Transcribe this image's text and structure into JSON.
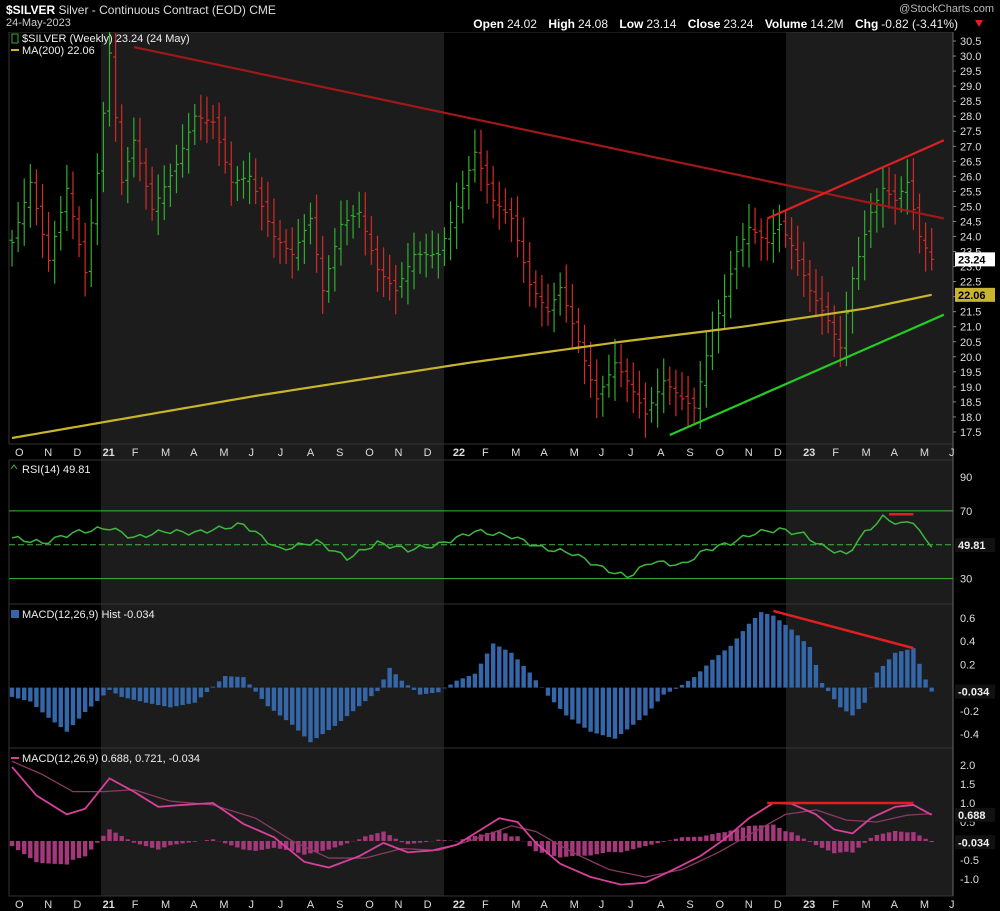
{
  "header": {
    "symbol": "$SILVER",
    "name": "Silver - Continuous Contract (EOD)",
    "exchange": "CME",
    "date": "24-May-2023",
    "watermark": "@StockCharts.com",
    "open_label": "Open",
    "open": "24.02",
    "high_label": "High",
    "high": "24.08",
    "low_label": "Low",
    "low": "23.14",
    "close_label": "Close",
    "close": "23.24",
    "volume_label": "Volume",
    "volume": "14.2M",
    "chg_label": "Chg",
    "chg": "-0.82 (-3.41%)",
    "chg_icon": "triangle-down-icon"
  },
  "colors": {
    "up": "#2fae2f",
    "down": "#d42a2a",
    "ma": "#c9b52a",
    "background": "#000000",
    "band": "#1c1c1c",
    "grid": "#333333",
    "axis_text": "#dddddd",
    "rsi_line": "#3cb83c",
    "hist": "#3466a8",
    "macd_line": "#d8409a",
    "macd_signal": "#8a3a64",
    "macd_hist": "#a3387a",
    "trend_red": "#e02020",
    "trend_green": "#22cc22",
    "trend_dark_red": "#a01818",
    "marker_bg": "#ffffff"
  },
  "chart_data": [
    {
      "type": "candlestick",
      "title": "$SILVER (Weekly) 23.24 (24 May)",
      "legend": [
        {
          "label": "$SILVER (Weekly) 23.24 (24 May)",
          "icon": "price-bar-icon"
        },
        {
          "label": "MA(200) 22.06",
          "icon": "ma-line-icon"
        }
      ],
      "y_ticks": [
        "17.5",
        "18.0",
        "18.5",
        "19.0",
        "19.5",
        "20.0",
        "20.5",
        "21.0",
        "21.5",
        "22.0",
        "22.5",
        "23.0",
        "23.5",
        "24.0",
        "24.5",
        "25.0",
        "25.5",
        "26.0",
        "26.5",
        "27.0",
        "27.5",
        "28.0",
        "28.5",
        "29.0",
        "29.5",
        "30.0",
        "30.5"
      ],
      "ylim": [
        17.1,
        30.8
      ],
      "x_ticks": [
        "O",
        "N",
        "D",
        "21",
        "F",
        "M",
        "A",
        "M",
        "J",
        "J",
        "A",
        "S",
        "O",
        "N",
        "D",
        "22",
        "F",
        "M",
        "A",
        "M",
        "J",
        "J",
        "A",
        "S",
        "O",
        "N",
        "D",
        "23",
        "F",
        "M",
        "A",
        "M",
        "J"
      ],
      "keypoints": [
        {
          "w": 0,
          "v": 23.8
        },
        {
          "w": 3,
          "v": 25.8
        },
        {
          "w": 6,
          "v": 23.2
        },
        {
          "w": 9,
          "v": 25.6
        },
        {
          "w": 12,
          "v": 22.8
        },
        {
          "w": 14,
          "v": 26.1
        },
        {
          "w": 16,
          "v": 30.1
        },
        {
          "w": 18,
          "v": 25.8
        },
        {
          "w": 20,
          "v": 27.2
        },
        {
          "w": 23,
          "v": 24.9
        },
        {
          "w": 27,
          "v": 26.4
        },
        {
          "w": 30,
          "v": 28.0
        },
        {
          "w": 33,
          "v": 27.8
        },
        {
          "w": 36,
          "v": 25.8
        },
        {
          "w": 39,
          "v": 26.0
        },
        {
          "w": 43,
          "v": 24.0
        },
        {
          "w": 46,
          "v": 23.4
        },
        {
          "w": 49,
          "v": 24.6
        },
        {
          "w": 51,
          "v": 22.2
        },
        {
          "w": 54,
          "v": 24.4
        },
        {
          "w": 57,
          "v": 24.8
        },
        {
          "w": 60,
          "v": 22.9
        },
        {
          "w": 63,
          "v": 22.2
        },
        {
          "w": 66,
          "v": 23.4
        },
        {
          "w": 70,
          "v": 23.4
        },
        {
          "w": 73,
          "v": 25.0
        },
        {
          "w": 75,
          "v": 26.2
        },
        {
          "w": 76,
          "v": 26.8
        },
        {
          "w": 79,
          "v": 25.2
        },
        {
          "w": 82,
          "v": 24.6
        },
        {
          "w": 85,
          "v": 22.4
        },
        {
          "w": 88,
          "v": 21.5
        },
        {
          "w": 90,
          "v": 22.3
        },
        {
          "w": 93,
          "v": 20.5
        },
        {
          "w": 96,
          "v": 18.6
        },
        {
          "w": 99,
          "v": 19.8
        },
        {
          "w": 101,
          "v": 19.2
        },
        {
          "w": 104,
          "v": 18.1
        },
        {
          "w": 107,
          "v": 19.2
        },
        {
          "w": 110,
          "v": 18.6
        },
        {
          "w": 112,
          "v": 18.3
        },
        {
          "w": 115,
          "v": 20.9
        },
        {
          "w": 117,
          "v": 22.0
        },
        {
          "w": 119,
          "v": 23.5
        },
        {
          "w": 121,
          "v": 24.3
        },
        {
          "w": 124,
          "v": 23.8
        },
        {
          "w": 126,
          "v": 24.4
        },
        {
          "w": 128,
          "v": 23.7
        },
        {
          "w": 131,
          "v": 22.2
        },
        {
          "w": 134,
          "v": 21.2
        },
        {
          "w": 136,
          "v": 20.3
        },
        {
          "w": 138,
          "v": 22.6
        },
        {
          "w": 141,
          "v": 24.8
        },
        {
          "w": 143,
          "v": 25.6
        },
        {
          "w": 145,
          "v": 25.2
        },
        {
          "w": 147,
          "v": 25.8
        },
        {
          "w": 149,
          "v": 24.0
        },
        {
          "w": 151,
          "v": 23.24
        }
      ],
      "ma200": [
        {
          "w": 0,
          "v": 17.3
        },
        {
          "w": 40,
          "v": 18.7
        },
        {
          "w": 75,
          "v": 19.8
        },
        {
          "w": 100,
          "v": 20.5
        },
        {
          "w": 120,
          "v": 21.0
        },
        {
          "w": 140,
          "v": 21.6
        },
        {
          "w": 151,
          "v": 22.06
        }
      ],
      "trendlines": [
        {
          "name": "resistance-line",
          "from": [
            20,
            30.3
          ],
          "to": [
            153,
            24.6
          ],
          "color": "trend_dark_red"
        },
        {
          "name": "upper-channel-line",
          "from": [
            124,
            24.6
          ],
          "to": [
            153,
            27.2
          ],
          "color": "trend_red"
        },
        {
          "name": "support-line",
          "from": [
            108,
            17.4
          ],
          "to": [
            153,
            21.4
          ],
          "color": "trend_green"
        }
      ],
      "last_value": "23.24",
      "ma_value": "22.06"
    },
    {
      "type": "line",
      "title": "RSI(14) 49.81",
      "ylim": [
        15,
        100
      ],
      "y_ticks": [
        "30",
        "50",
        "70",
        "90"
      ],
      "reference_lines": [
        30,
        70
      ],
      "keypoints": [
        {
          "w": 0,
          "v": 54
        },
        {
          "w": 5,
          "v": 51
        },
        {
          "w": 10,
          "v": 57
        },
        {
          "w": 16,
          "v": 60
        },
        {
          "w": 20,
          "v": 54
        },
        {
          "w": 25,
          "v": 58
        },
        {
          "w": 30,
          "v": 57
        },
        {
          "w": 38,
          "v": 62
        },
        {
          "w": 44,
          "v": 47
        },
        {
          "w": 50,
          "v": 52
        },
        {
          "w": 55,
          "v": 42
        },
        {
          "w": 60,
          "v": 51
        },
        {
          "w": 65,
          "v": 47
        },
        {
          "w": 70,
          "v": 50
        },
        {
          "w": 76,
          "v": 58
        },
        {
          "w": 82,
          "v": 55
        },
        {
          "w": 87,
          "v": 48
        },
        {
          "w": 92,
          "v": 45
        },
        {
          "w": 97,
          "v": 36
        },
        {
          "w": 101,
          "v": 31
        },
        {
          "w": 105,
          "v": 40
        },
        {
          "w": 110,
          "v": 38
        },
        {
          "w": 114,
          "v": 47
        },
        {
          "w": 118,
          "v": 51
        },
        {
          "w": 122,
          "v": 57
        },
        {
          "w": 126,
          "v": 59
        },
        {
          "w": 130,
          "v": 56
        },
        {
          "w": 133,
          "v": 49
        },
        {
          "w": 137,
          "v": 44
        },
        {
          "w": 140,
          "v": 57
        },
        {
          "w": 143,
          "v": 66
        },
        {
          "w": 146,
          "v": 62
        },
        {
          "w": 148,
          "v": 64
        },
        {
          "w": 150,
          "v": 52
        },
        {
          "w": 151,
          "v": 49.81
        }
      ],
      "divergence_line": {
        "from": [
          144,
          68
        ],
        "to": [
          148,
          68
        ]
      },
      "last_value": "49.81"
    },
    {
      "type": "bar",
      "title": "MACD(12,26,9) Hist -0.034",
      "ylim": [
        -0.52,
        0.72
      ],
      "y_ticks": [
        "-0.4",
        "-0.2",
        "0.0",
        "0.2",
        "0.4",
        "0.6"
      ],
      "keypoints": [
        {
          "w": 0,
          "v": -0.08
        },
        {
          "w": 3,
          "v": -0.12
        },
        {
          "w": 6,
          "v": -0.26
        },
        {
          "w": 9,
          "v": -0.38
        },
        {
          "w": 12,
          "v": -0.21
        },
        {
          "w": 16,
          "v": -0.02
        },
        {
          "w": 18,
          "v": -0.08
        },
        {
          "w": 22,
          "v": -0.13
        },
        {
          "w": 26,
          "v": -0.17
        },
        {
          "w": 30,
          "v": -0.13
        },
        {
          "w": 35,
          "v": 0.1
        },
        {
          "w": 38,
          "v": 0.09
        },
        {
          "w": 42,
          "v": -0.16
        },
        {
          "w": 46,
          "v": -0.32
        },
        {
          "w": 49,
          "v": -0.47
        },
        {
          "w": 53,
          "v": -0.33
        },
        {
          "w": 57,
          "v": -0.16
        },
        {
          "w": 60,
          "v": -0.03
        },
        {
          "w": 62,
          "v": 0.17
        },
        {
          "w": 64,
          "v": 0.06
        },
        {
          "w": 67,
          "v": -0.06
        },
        {
          "w": 70,
          "v": -0.04
        },
        {
          "w": 73,
          "v": 0.06
        },
        {
          "w": 76,
          "v": 0.12
        },
        {
          "w": 79,
          "v": 0.38
        },
        {
          "w": 82,
          "v": 0.3
        },
        {
          "w": 85,
          "v": 0.13
        },
        {
          "w": 88,
          "v": -0.07
        },
        {
          "w": 91,
          "v": -0.24
        },
        {
          "w": 95,
          "v": -0.38
        },
        {
          "w": 99,
          "v": -0.44
        },
        {
          "w": 101,
          "v": -0.36
        },
        {
          "w": 104,
          "v": -0.24
        },
        {
          "w": 107,
          "v": -0.06
        },
        {
          "w": 109,
          "v": -0.01
        },
        {
          "w": 112,
          "v": 0.09
        },
        {
          "w": 115,
          "v": 0.24
        },
        {
          "w": 118,
          "v": 0.36
        },
        {
          "w": 121,
          "v": 0.55
        },
        {
          "w": 123,
          "v": 0.65
        },
        {
          "w": 125,
          "v": 0.62
        },
        {
          "w": 128,
          "v": 0.5
        },
        {
          "w": 131,
          "v": 0.35
        },
        {
          "w": 133,
          "v": 0.04
        },
        {
          "w": 136,
          "v": -0.17
        },
        {
          "w": 138,
          "v": -0.24
        },
        {
          "w": 140,
          "v": -0.13
        },
        {
          "w": 142,
          "v": 0.13
        },
        {
          "w": 145,
          "v": 0.3
        },
        {
          "w": 148,
          "v": 0.34
        },
        {
          "w": 150,
          "v": 0.07
        },
        {
          "w": 151,
          "v": -0.034
        }
      ],
      "divergence_line": {
        "from": [
          125,
          0.66
        ],
        "to": [
          148,
          0.34
        ]
      },
      "last_value": "-0.034"
    },
    {
      "type": "line",
      "title": "MACD(12,26,9) 0.688, 0.721, -0.034",
      "ylim": [
        -1.45,
        2.45
      ],
      "y_ticks": [
        "-1.0",
        "-0.5",
        "0.0",
        "0.5",
        "1.0",
        "1.5",
        "2.0"
      ],
      "macd_keypoints": [
        {
          "w": 0,
          "v": 1.95
        },
        {
          "w": 4,
          "v": 1.2
        },
        {
          "w": 9,
          "v": 0.7
        },
        {
          "w": 12,
          "v": 0.85
        },
        {
          "w": 16,
          "v": 1.65
        },
        {
          "w": 20,
          "v": 1.3
        },
        {
          "w": 24,
          "v": 0.9
        },
        {
          "w": 28,
          "v": 0.95
        },
        {
          "w": 33,
          "v": 1.0
        },
        {
          "w": 38,
          "v": 0.45
        },
        {
          "w": 43,
          "v": 0.1
        },
        {
          "w": 48,
          "v": -0.55
        },
        {
          "w": 52,
          "v": -0.7
        },
        {
          "w": 57,
          "v": -0.4
        },
        {
          "w": 61,
          "v": -0.05
        },
        {
          "w": 65,
          "v": -0.3
        },
        {
          "w": 69,
          "v": -0.25
        },
        {
          "w": 73,
          "v": -0.1
        },
        {
          "w": 77,
          "v": 0.3
        },
        {
          "w": 80,
          "v": 0.6
        },
        {
          "w": 83,
          "v": 0.5
        },
        {
          "w": 86,
          "v": -0.05
        },
        {
          "w": 90,
          "v": -0.6
        },
        {
          "w": 95,
          "v": -0.95
        },
        {
          "w": 100,
          "v": -1.15
        },
        {
          "w": 104,
          "v": -1.1
        },
        {
          "w": 108,
          "v": -0.8
        },
        {
          "w": 113,
          "v": -0.4
        },
        {
          "w": 117,
          "v": 0.05
        },
        {
          "w": 121,
          "v": 0.6
        },
        {
          "w": 125,
          "v": 1.0
        },
        {
          "w": 128,
          "v": 0.98
        },
        {
          "w": 132,
          "v": 0.7
        },
        {
          "w": 135,
          "v": 0.3
        },
        {
          "w": 138,
          "v": 0.2
        },
        {
          "w": 141,
          "v": 0.6
        },
        {
          "w": 145,
          "v": 0.9
        },
        {
          "w": 148,
          "v": 0.95
        },
        {
          "w": 151,
          "v": 0.688
        }
      ],
      "signal_keypoints": [
        {
          "w": 0,
          "v": 2.1
        },
        {
          "w": 5,
          "v": 1.75
        },
        {
          "w": 10,
          "v": 1.3
        },
        {
          "w": 15,
          "v": 1.3
        },
        {
          "w": 20,
          "v": 1.35
        },
        {
          "w": 26,
          "v": 1.05
        },
        {
          "w": 33,
          "v": 0.95
        },
        {
          "w": 40,
          "v": 0.6
        },
        {
          "w": 46,
          "v": 0.0
        },
        {
          "w": 52,
          "v": -0.45
        },
        {
          "w": 58,
          "v": -0.45
        },
        {
          "w": 64,
          "v": -0.2
        },
        {
          "w": 70,
          "v": -0.25
        },
        {
          "w": 76,
          "v": 0.05
        },
        {
          "w": 82,
          "v": 0.4
        },
        {
          "w": 86,
          "v": 0.25
        },
        {
          "w": 92,
          "v": -0.3
        },
        {
          "w": 98,
          "v": -0.75
        },
        {
          "w": 104,
          "v": -0.95
        },
        {
          "w": 110,
          "v": -0.75
        },
        {
          "w": 116,
          "v": -0.3
        },
        {
          "w": 122,
          "v": 0.25
        },
        {
          "w": 127,
          "v": 0.7
        },
        {
          "w": 132,
          "v": 0.82
        },
        {
          "w": 137,
          "v": 0.55
        },
        {
          "w": 142,
          "v": 0.5
        },
        {
          "w": 147,
          "v": 0.68
        },
        {
          "w": 151,
          "v": 0.721
        }
      ],
      "divergence_line": {
        "from": [
          124,
          1.0
        ],
        "to": [
          148,
          1.0
        ]
      },
      "last_values": [
        "0.688",
        "-0.034"
      ]
    }
  ]
}
